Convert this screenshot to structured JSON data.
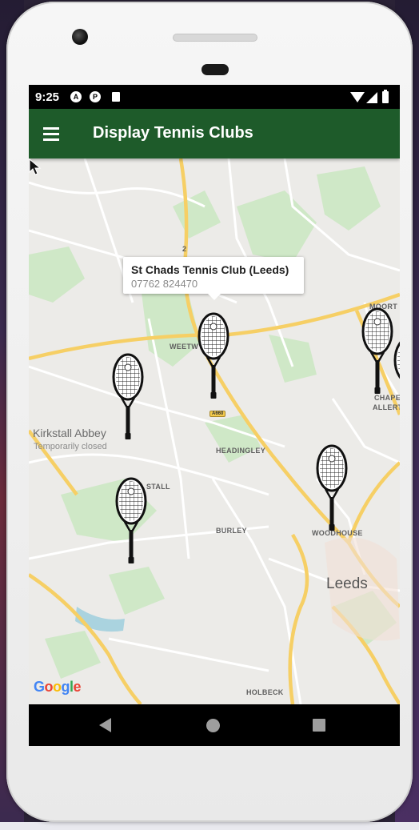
{
  "status_bar": {
    "time": "9:25",
    "icons": [
      "a-circle-icon",
      "p-circle-icon",
      "sd-card-icon",
      "wifi-icon",
      "signal-icon",
      "battery-icon"
    ]
  },
  "app_bar": {
    "title": "Display Tennis Clubs",
    "menu_icon": "hamburger-menu-icon",
    "color": "#1e5b2a"
  },
  "info_window": {
    "title": "St Chads Tennis Club (Leeds)",
    "phone": "07762 824470"
  },
  "markers": [
    {
      "name": "tennis-racket-marker",
      "icon": "tennis-racket-icon"
    },
    {
      "name": "tennis-racket-marker",
      "icon": "tennis-racket-icon"
    },
    {
      "name": "tennis-racket-marker",
      "icon": "tennis-racket-icon"
    },
    {
      "name": "tennis-racket-marker",
      "icon": "tennis-racket-icon"
    },
    {
      "name": "tennis-racket-marker",
      "icon": "tennis-racket-icon"
    }
  ],
  "map_labels": {
    "kirkstall_abbey": "Kirkstall Abbey",
    "temporarily_closed": "Temporarily closed",
    "headingley": "HEADINGLEY",
    "weetwood": "WEETW",
    "kirkstall": "STALL",
    "burley": "BURLEY",
    "woodhouse": "WOODHOUSE",
    "leeds": "Leeds",
    "holbeck": "HOLBECK",
    "moortown": "MOORT",
    "chapel_1": "CHAPE",
    "chapel_2": "ALLERT",
    "road_a660": "A660",
    "road_2": "2"
  },
  "google_logo": {
    "letters": [
      "G",
      "o",
      "o",
      "g",
      "l",
      "e"
    ],
    "colors": [
      "#4285f4",
      "#ea4335",
      "#fbbc05",
      "#4285f4",
      "#34a853",
      "#ea4335"
    ]
  },
  "nav_bar": {
    "icons": [
      "back-icon",
      "home-icon",
      "recents-icon"
    ]
  }
}
